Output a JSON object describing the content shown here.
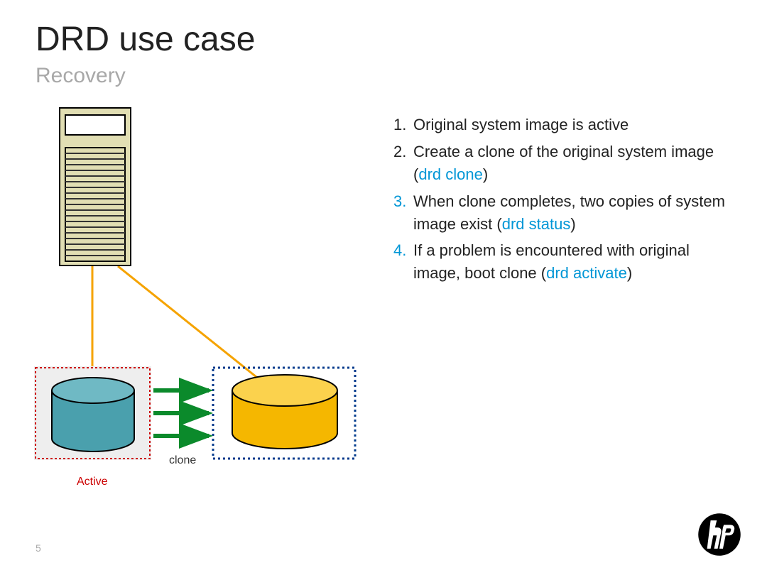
{
  "title": "DRD use case",
  "subtitle": "Recovery",
  "pagenum": "5",
  "labels": {
    "active": "Active",
    "clone": "clone"
  },
  "steps": [
    {
      "num": "1.",
      "num_hi": false,
      "parts": [
        {
          "t": "Original system image is active",
          "hi": false
        }
      ]
    },
    {
      "num": "2.",
      "num_hi": false,
      "parts": [
        {
          "t": "Create a clone of the original system image (",
          "hi": false
        },
        {
          "t": "drd clone",
          "hi": true
        },
        {
          "t": ")",
          "hi": false
        }
      ]
    },
    {
      "num": "3.",
      "num_hi": true,
      "parts": [
        {
          "t": "When clone completes, two copies of system image exist (",
          "hi": false
        },
        {
          "t": "drd status",
          "hi": true
        },
        {
          "t": ")",
          "hi": false
        }
      ]
    },
    {
      "num": "4.",
      "num_hi": true,
      "parts": [
        {
          "t": "If a problem is encountered with original image, boot clone (",
          "hi": false
        },
        {
          "t": "drd activate",
          "hi": true
        },
        {
          "t": ")",
          "hi": false
        }
      ]
    }
  ]
}
